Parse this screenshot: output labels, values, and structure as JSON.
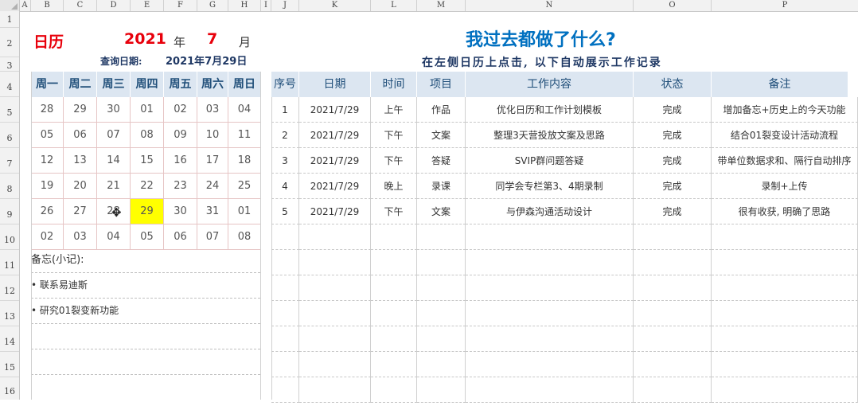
{
  "column_headers": [
    "A",
    "B",
    "C",
    "D",
    "E",
    "F",
    "G",
    "H",
    "I",
    "J",
    "K",
    "L",
    "M",
    "N",
    "O",
    "P"
  ],
  "row_headers": [
    "1",
    "2",
    "3",
    "4",
    "5",
    "6",
    "7",
    "8",
    "9",
    "10",
    "11",
    "12",
    "13",
    "14",
    "15",
    "16"
  ],
  "calendar": {
    "title": "日历",
    "year": "2021",
    "year_unit": "年",
    "month": "7",
    "month_unit": "月",
    "query_label": "查询日期:",
    "query_date": "2021年7月29日",
    "weekdays": [
      "周一",
      "周二",
      "周三",
      "周四",
      "周五",
      "周六",
      "周日"
    ],
    "weeks": [
      [
        "28",
        "29",
        "30",
        "01",
        "02",
        "03",
        "04"
      ],
      [
        "05",
        "06",
        "07",
        "08",
        "09",
        "10",
        "11"
      ],
      [
        "12",
        "13",
        "14",
        "15",
        "16",
        "17",
        "18"
      ],
      [
        "19",
        "20",
        "21",
        "22",
        "23",
        "24",
        "25"
      ],
      [
        "26",
        "27",
        "28",
        "29",
        "30",
        "31",
        "01"
      ],
      [
        "02",
        "03",
        "04",
        "05",
        "06",
        "07",
        "08"
      ]
    ],
    "selected_date": "29",
    "selected_color": "#ffff00"
  },
  "memo": {
    "title": "备忘(小记):",
    "items": [
      "• 联系易迪斯",
      "• 研究01裂变新功能"
    ]
  },
  "worklog": {
    "title": "我过去都做了什么?",
    "subtitle": "在左侧日历上点击, 以下自动展示工作记录",
    "columns": [
      "序号",
      "日期",
      "时间",
      "项目",
      "工作内容",
      "状态",
      "备注"
    ],
    "rows": [
      [
        "1",
        "2021/7/29",
        "上午",
        "作品",
        "优化日历和工作计划模板",
        "完成",
        "增加备忘+历史上的今天功能"
      ],
      [
        "2",
        "2021/7/29",
        "下午",
        "文案",
        "整理3天营投放文案及思路",
        "完成",
        "结合01裂变设计活动流程"
      ],
      [
        "3",
        "2021/7/29",
        "下午",
        "答疑",
        "SVIP群问题答疑",
        "完成",
        "带单位数据求和、隔行自动排序"
      ],
      [
        "4",
        "2021/7/29",
        "晚上",
        "录课",
        "同学会专栏第3、4期录制",
        "完成",
        "录制+上传"
      ],
      [
        "5",
        "2021/7/29",
        "下午",
        "文案",
        "与伊森沟通活动设计",
        "完成",
        "很有收获, 明确了思路"
      ]
    ]
  },
  "colors": {
    "header_fill": "#dce6f1",
    "header_text": "#1f4e79",
    "title_blue": "#0070c0",
    "title_red": "#e8000b",
    "subtitle_navy": "#1f3864"
  }
}
